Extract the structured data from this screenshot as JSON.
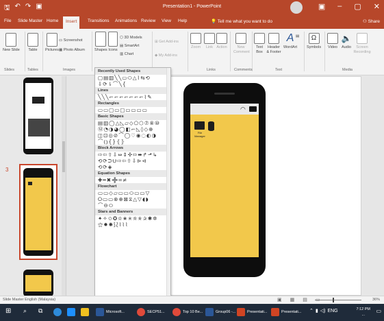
{
  "window": {
    "title": "Presentation1 - PowerPoint",
    "qat": [
      "save-icon",
      "undo-icon",
      "redo-icon",
      "present-icon"
    ],
    "controls": [
      "minimize-icon",
      "maximize-icon",
      "close-icon"
    ]
  },
  "tabs": [
    "File",
    "Slide Master",
    "Home",
    "Insert",
    "Transitions",
    "Animations",
    "Review",
    "View",
    "Help"
  ],
  "active_tab": "Insert",
  "tell_me": "Tell me what you want to do",
  "share": "Share",
  "ribbon": {
    "groups": [
      "Slides",
      "Tables",
      "Images",
      "Links",
      "Comments",
      "Text",
      "Media"
    ],
    "buttons": {
      "new_slide": "New Slide",
      "table": "Table",
      "pictures": "Pictures",
      "screenshot": "Screenshot",
      "photo_album": "Photo Album",
      "shapes": "Shapes",
      "icons": "Icons",
      "models_3d": "3D Models",
      "smartart": "SmartArt",
      "chart": "Chart",
      "get_addins": "Get Add-ins",
      "my_addins": "My Add-ins",
      "zoom": "Zoom",
      "link": "Link",
      "action": "Action",
      "new_comment": "New Comment",
      "text_box": "Text Box",
      "header_footer": "Header & Footer",
      "wordart": "WordArt",
      "symbols": "Symbols",
      "video": "Video",
      "audio": "Audio",
      "screen_recording": "Screen Recording"
    }
  },
  "shapes_panel": {
    "sections": [
      {
        "title": "Recently Used Shapes",
        "rows": [
          "▢▤▥╲╲▭⬭△⌇⇆⟲",
          "⇩⟳⇂⌒╲{"
        ]
      },
      {
        "title": "Lines",
        "rows": [
          "╲╲╲⌐⌐⌐⌐⌐⌐⌐⌇✎"
        ]
      },
      {
        "title": "Rectangles",
        "rows": [
          "▭▭▢▭▢▭▭▭▭"
        ]
      },
      {
        "title": "Basic Shapes",
        "rows": [
          "▤▥◯△◺▱◇⬠⬡⑦⑧⑩",
          "⑫◔◑◕◯◧⌐◺◊◇⊕",
          "◫⊡◎⊘⌒◯♡◉◌◐◑",
          "⌒⦅⦆{}⦃⦄"
        ]
      },
      {
        "title": "Block Arrows",
        "rows": [
          "⇨⇦⇧⇩⇔⇕✣⬄⬌↱⬏↳",
          "⟲⟳⮊⮋⇨⇦⇧⇩⊳⊲",
          "⟲⟳◈"
        ]
      },
      {
        "title": "Equation Shapes",
        "rows": [
          "✚━✖➗═≠"
        ]
      },
      {
        "title": "Flowchart",
        "rows": [
          "▭▭◇▱▭▭⬭▭▭▽",
          "⭘▭▭⊗⊕⊠⧖△▽◖◗",
          "⌒⊖⬭"
        ]
      },
      {
        "title": "Stars and Banners",
        "rows": [
          "✦✧✩✪✫✬✭✮✯✰✱✲",
          "⚝✹✺⟆⟅⌇⌇⌇"
        ]
      }
    ]
  },
  "slides_panel": {
    "selected_number": "3"
  },
  "phone": {
    "folder_label": "File Manager"
  },
  "statusbar": {
    "left": "Slide Master   English (Malaysia)",
    "zoom": "36%"
  },
  "taskbar": {
    "items": [
      "Microsoft...",
      "SECP51...",
      "Top 10 Be...",
      "Group06 -...",
      "Presentati...",
      "Presentati..."
    ],
    "time": "7:12 PM",
    "date": "...",
    "lang": "ENG"
  },
  "colors": {
    "accent": "#b7472a",
    "screen_yellow": "#f2c84b",
    "phone_black": "#0d0d0d",
    "selection": "#c9462c"
  }
}
